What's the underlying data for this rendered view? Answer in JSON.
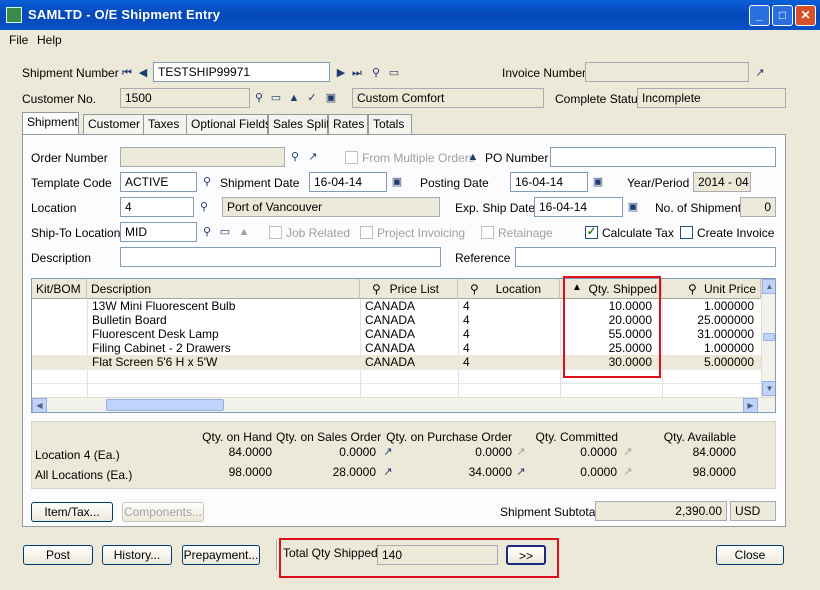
{
  "window": {
    "title": "SAMLTD - O/E Shipment Entry"
  },
  "menu": {
    "file": "File",
    "help": "Help"
  },
  "header": {
    "shipment_number_label": "Shipment Number",
    "shipment_number": "TESTSHIP99971",
    "invoice_number_label": "Invoice Number",
    "invoice_number": "",
    "customer_no_label": "Customer No.",
    "customer_no": "1500",
    "customer_name": "Custom Comfort",
    "complete_status_label": "Complete Status",
    "complete_status": "Incomplete"
  },
  "tabs": [
    {
      "label": "Shipment"
    },
    {
      "label": "Customer"
    },
    {
      "label": "Taxes"
    },
    {
      "label": "Optional Fields"
    },
    {
      "label": "Sales Split"
    },
    {
      "label": "Rates"
    },
    {
      "label": "Totals"
    }
  ],
  "form": {
    "order_number_label": "Order Number",
    "order_number": "",
    "from_multiple_orders_label": "From Multiple Orders",
    "po_number_label": "PO Number",
    "po_number": "",
    "template_code_label": "Template Code",
    "template_code": "ACTIVE",
    "shipment_date_label": "Shipment Date",
    "shipment_date": "16-04-14",
    "posting_date_label": "Posting Date",
    "posting_date": "16-04-14",
    "year_period_label": "Year/Period",
    "year_period": "2014 - 04",
    "location_label": "Location",
    "location": "4",
    "location_name": "Port of Vancouver",
    "exp_ship_date_label": "Exp. Ship Date",
    "exp_ship_date": "16-04-14",
    "no_of_shipments_label": "No. of Shipments",
    "no_of_shipments": "0",
    "ship_to_location_label": "Ship-To Location",
    "ship_to_location": "MID",
    "job_related_label": "Job Related",
    "project_invoicing_label": "Project Invoicing",
    "retainage_label": "Retainage",
    "calculate_tax_label": "Calculate Tax",
    "calculate_tax_checked": true,
    "create_invoice_label": "Create Invoice",
    "create_invoice_checked": false,
    "description_label": "Description",
    "description": "",
    "reference_label": "Reference",
    "reference": ""
  },
  "grid": {
    "columns": [
      "Kit/BOM",
      "Description",
      "Price List",
      "Location",
      "Qty. Shipped",
      "Unit Price"
    ],
    "rows": [
      {
        "kit": "",
        "description": "13W Mini Fluorescent Bulb",
        "price_list": "CANADA",
        "location": "4",
        "qty_shipped": "10.0000",
        "unit_price": "1.000000"
      },
      {
        "kit": "",
        "description": "Bulletin Board",
        "price_list": "CANADA",
        "location": "4",
        "qty_shipped": "20.0000",
        "unit_price": "25.000000"
      },
      {
        "kit": "",
        "description": "Fluorescent Desk Lamp",
        "price_list": "CANADA",
        "location": "4",
        "qty_shipped": "55.0000",
        "unit_price": "31.000000"
      },
      {
        "kit": "",
        "description": "Filing Cabinet - 2 Drawers",
        "price_list": "CANADA",
        "location": "4",
        "qty_shipped": "25.0000",
        "unit_price": "1.000000"
      },
      {
        "kit": "",
        "description": "Flat Screen 5'6 H x 5'W",
        "price_list": "CANADA",
        "location": "4",
        "qty_shipped": "30.0000",
        "unit_price": "5.000000"
      }
    ]
  },
  "totals": {
    "headers": [
      "Qty. on Hand",
      "Qty. on Sales Order",
      "Qty. on Purchase Order",
      "Qty. Committed",
      "Qty. Available"
    ],
    "location_label": "Location  4 (Ea.)",
    "location_values": [
      "84.0000",
      "0.0000",
      "0.0000",
      "0.0000",
      "84.0000"
    ],
    "all_label": "All Locations (Ea.)",
    "all_values": [
      "98.0000",
      "28.0000",
      "34.0000",
      "0.0000",
      "98.0000"
    ]
  },
  "buttons": {
    "item_tax": "Item/Tax...",
    "components": "Components...",
    "post": "Post",
    "history": "History...",
    "prepayment": "Prepayment...",
    "more": ">>",
    "close": "Close"
  },
  "subtotal": {
    "label": "Shipment Subtotal",
    "value": "2,390.00",
    "currency": "USD"
  },
  "footer": {
    "total_qty_label": "Total Qty Shipped",
    "total_qty": "140"
  },
  "colors": {
    "highlight": "#e0101a",
    "titlebar": "#0548b8"
  }
}
